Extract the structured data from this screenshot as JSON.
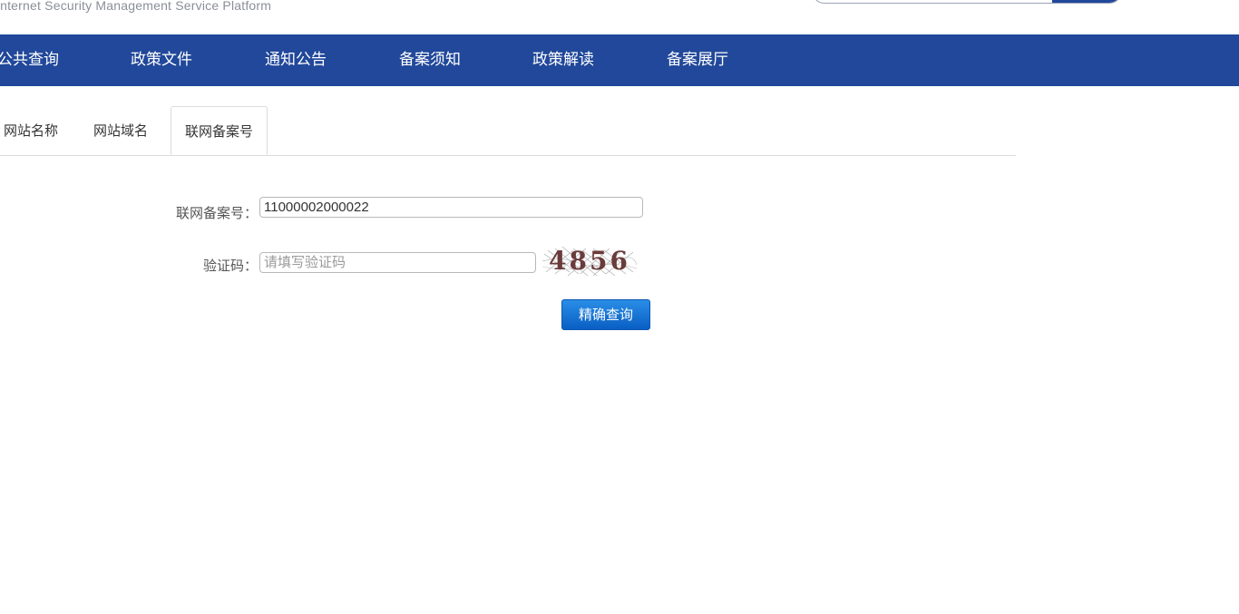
{
  "header": {
    "subtitle": "Internet Security Management Service Platform"
  },
  "nav": {
    "items": [
      {
        "label": "公共查询"
      },
      {
        "label": "政策文件"
      },
      {
        "label": "通知公告"
      },
      {
        "label": "备案须知"
      },
      {
        "label": "政策解读"
      },
      {
        "label": "备案展厅"
      }
    ],
    "background_color": "#21489a"
  },
  "tabs": {
    "items": [
      {
        "label": "网站名称",
        "active": false
      },
      {
        "label": "网站域名",
        "active": false
      },
      {
        "label": "联网备案号",
        "active": true
      }
    ]
  },
  "form": {
    "record_number": {
      "label": "联网备案号：",
      "value": "11000002000022"
    },
    "captcha": {
      "label": "验证码：",
      "placeholder": "请填写验证码",
      "value": "",
      "image_text": "4856"
    },
    "submit_label": "精确查询"
  },
  "colors": {
    "accent": "#21489a",
    "button": "#1a74d6"
  }
}
